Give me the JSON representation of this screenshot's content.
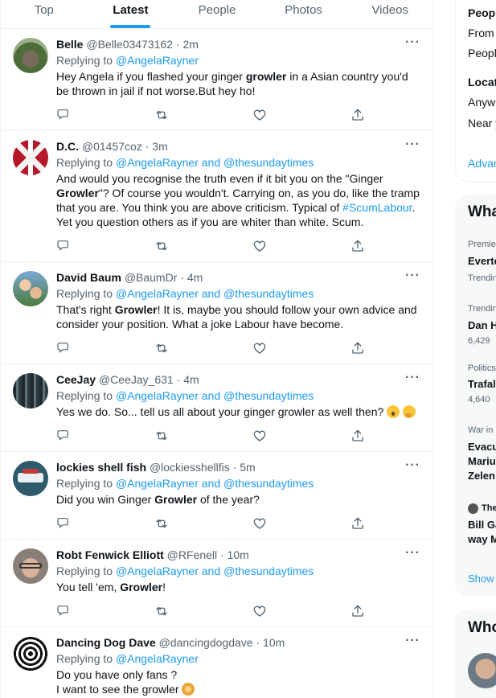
{
  "tabs": [
    "Top",
    "Latest",
    "People",
    "Photos",
    "Videos"
  ],
  "tweets": [
    {
      "name": "Belle",
      "handle": "@Belle03473162",
      "time": "2m",
      "replying_prefix": "Replying to ",
      "replying_to": "@AngelaRayner",
      "replying_join": "",
      "replying_to2": "",
      "body": [
        "Hey Angela  if you flashed  your ginger ",
        "growler",
        " in a Asian country you'd be thrown in jail if not worse.But hey ho!"
      ]
    },
    {
      "name": "D.C.",
      "handle": "@01457coz",
      "time": "3m",
      "replying_prefix": "Replying to ",
      "replying_to": "@AngelaRayner",
      "replying_join": " and ",
      "replying_to2": "@thesundaytimes",
      "body": [
        "And would you recognise the truth even if it bit you on the \"Ginger ",
        "Growler",
        "\"? Of course you wouldn't.  Carrying on, as you do, like the tramp that you are. You think you are above criticism.  Typical of ",
        "#ScumLabour",
        ". Yet you question others as if you are whiter than white. Scum."
      ]
    },
    {
      "name": "David Baum",
      "handle": "@BaumDr",
      "time": "4m",
      "replying_prefix": "Replying to ",
      "replying_to": "@AngelaRayner",
      "replying_join": " and ",
      "replying_to2": "@thesundaytimes",
      "body": [
        "That's right ",
        "Growler",
        "! It is, maybe you should follow your own advice and consider your position. What a joke Labour have become."
      ]
    },
    {
      "name": "CeeJay",
      "handle": "@CeeJay_631",
      "time": "4m",
      "replying_prefix": "Replying to ",
      "replying_to": "@AngelaRayner",
      "replying_join": " and ",
      "replying_to2": "@thesundaytimes",
      "body": [
        "Yes we do. So... tell us all about your ginger growler as well then? "
      ]
    },
    {
      "name": "lockies shell fish",
      "handle": "@lockiesshellfis",
      "time": "5m",
      "replying_prefix": "Replying to ",
      "replying_to": "@AngelaRayner",
      "replying_join": " and ",
      "replying_to2": "@thesundaytimes",
      "body": [
        "Did you win Ginger ",
        "Growler",
        " of the year?"
      ]
    },
    {
      "name": "Robt Fenwick Elliott",
      "handle": "@RFenell",
      "time": "10m",
      "replying_prefix": "Replying to ",
      "replying_to": "@AngelaRayner",
      "replying_join": " and ",
      "replying_to2": "@thesundaytimes",
      "body": [
        "You tell 'em, ",
        "Growler",
        "!"
      ]
    },
    {
      "name": "Dancing Dog Dave",
      "handle": "@dancingdogdave",
      "time": "10m",
      "replying_prefix": "Replying to ",
      "replying_to": "@AngelaRayner",
      "replying_join": "",
      "replying_to2": "",
      "body": [
        "Do you have only fans ?",
        "I want  to see the growler "
      ]
    }
  ],
  "sep": " · ",
  "more_label": "···",
  "right": {
    "filter_people": "Peopl",
    "filter_from": "From",
    "filter_people2": "Peopl",
    "filter_location": "Locat",
    "filter_anywhere": "Anywh",
    "filter_near": "Near y",
    "advanced": "Advan",
    "whats_title": "Wha",
    "trends": [
      {
        "context": "Premie",
        "title": "Everto",
        "meta": "Trendin"
      },
      {
        "context": "Trendin",
        "title": "Dan H",
        "meta": "6,429"
      },
      {
        "context": "Politics",
        "title": "Trafal",
        "meta": "4,640"
      },
      {
        "context": "War in",
        "title": "Evacu",
        "title2": "Mariu",
        "title3": "Zelen"
      },
      {
        "context": "The",
        "title": "Bill Ga",
        "title2": "way M"
      }
    ],
    "show": "Show",
    "who_title": "Who"
  },
  "colors": {
    "accent": "#1d9bf0",
    "text": "#0f1419",
    "muted": "#536471",
    "border": "#eff3f4"
  }
}
